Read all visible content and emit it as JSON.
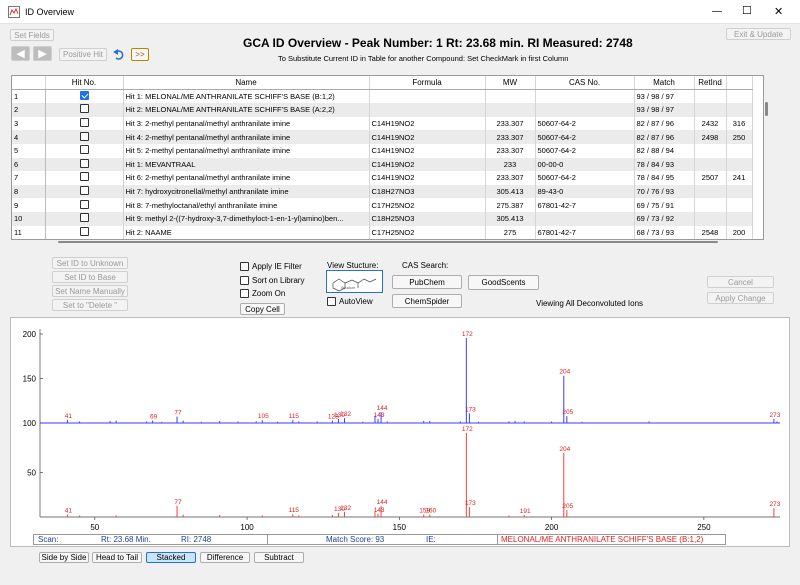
{
  "window": {
    "title": "ID Overview",
    "min": "—",
    "max": "☐",
    "close": "✕"
  },
  "toolbar": {
    "set_fields": "Set Fields",
    "positive_hit": "Positive Hit",
    "next": ">>",
    "exit_update": "Exit & Update"
  },
  "header": {
    "title": "GCA ID Overview - Peak Number: 1  Rt: 23.68 min.  RI Measured: 2748",
    "subtitle": "To Substitute Current ID in Table for another Compound: Set CheckMark in first Column"
  },
  "table": {
    "columns": [
      "",
      "Hit No.",
      "Name",
      "Formula",
      "MW",
      "CAS No.",
      "Match",
      "RetInd",
      ""
    ],
    "rows": [
      {
        "n": "1",
        "checked": true,
        "name": "Hit  1: MELONAL/ME ANTHRANILATE SCHIFF'S BASE (B:1,2)",
        "formula": "",
        "mw": "",
        "cas": "",
        "match": "93 / 98 / 97",
        "ri": "",
        "x": ""
      },
      {
        "n": "2",
        "checked": false,
        "name": "Hit  2: MELONAL/ME ANTHRANILATE SCHIFF'S BASE (A:2,2)",
        "formula": "",
        "mw": "",
        "cas": "",
        "match": "93 / 98 / 97",
        "ri": "",
        "x": ""
      },
      {
        "n": "3",
        "checked": false,
        "name": "Hit  3: 2-methyl pentanal/methyl anthranilate imine",
        "formula": "C14H19NO2",
        "mw": "233.307",
        "cas": "50607-64-2",
        "match": "82 / 87 / 96",
        "ri": "2432",
        "x": "316"
      },
      {
        "n": "4",
        "checked": false,
        "name": "Hit  4: 2-methyl pentanal/methyl anthranilate imine",
        "formula": "C14H19NO2",
        "mw": "233.307",
        "cas": "50607-64-2",
        "match": "82 / 87 / 96",
        "ri": "2498",
        "x": "250"
      },
      {
        "n": "5",
        "checked": false,
        "name": "Hit  5: 2-methyl pentanal/methyl anthranilate imine",
        "formula": "C14H19NO2",
        "mw": "233.307",
        "cas": "50607-64-2",
        "match": "82 / 88 / 94",
        "ri": "",
        "x": ""
      },
      {
        "n": "6",
        "checked": false,
        "name": "Hit  1: MEVANTRAAL",
        "formula": "C14H19NO2",
        "mw": "233",
        "cas": "00-00-0",
        "match": "78 / 84 / 93",
        "ri": "",
        "x": ""
      },
      {
        "n": "7",
        "checked": false,
        "name": "Hit  6: 2-methyl pentanal/methyl anthranilate imine",
        "formula": "C14H19NO2",
        "mw": "233.307",
        "cas": "50607-64-2",
        "match": "78 / 84 / 95",
        "ri": "2507",
        "x": "241"
      },
      {
        "n": "8",
        "checked": false,
        "name": "Hit  7: hydroxycitronellal/methyl anthranilate imine",
        "formula": "C18H27NO3",
        "mw": "305.413",
        "cas": "89-43-0",
        "match": "70 / 76 / 93",
        "ri": "",
        "x": ""
      },
      {
        "n": "9",
        "checked": false,
        "name": "Hit  8: 7-methyloctanal/ethyl anthranilate imine",
        "formula": "C17H25NO2",
        "mw": "275.387",
        "cas": "67801-42-7",
        "match": "69 / 75 / 91",
        "ri": "",
        "x": ""
      },
      {
        "n": "10",
        "checked": false,
        "name": "Hit  9: methyl 2-((7-hydroxy-3,7-dimethyloct-1-en-1-yl)amino)ben...",
        "formula": "C18H25NO3",
        "mw": "305.413",
        "cas": "",
        "match": "69 / 73 / 92",
        "ri": "",
        "x": ""
      },
      {
        "n": "11",
        "checked": false,
        "name": "Hit  2: NAAME",
        "formula": "C17H25NO2",
        "mw": "275",
        "cas": "67801-42-7",
        "match": "68 / 73 / 93",
        "ri": "2548",
        "x": "200"
      }
    ]
  },
  "actions": {
    "set_unknown": "Set ID to Unknown",
    "set_base": "Set ID to Base",
    "set_manual": "Set Name Manually",
    "set_delete": "Set to \"Delete \"",
    "copy_cell": "Copy Cell",
    "cancel": "Cancel",
    "apply_change": "Apply Change"
  },
  "options": {
    "apply_ie": "Apply IE Filter",
    "sort_library": "Sort on Library",
    "zoom_on": "Zoom On",
    "auto_view": "AutoView"
  },
  "structure": {
    "label": "View Stucture:",
    "caption": "Structure"
  },
  "cas_search": {
    "label": "CAS Search:",
    "pubchem": "PubChem",
    "chemspider": "ChemSpider",
    "goodscents": "GoodScents"
  },
  "ions_note": "Viewing All Deconvoluted Ions",
  "status": {
    "scan": "Scan:",
    "rt": "Rt: 23.68 Min.",
    "ri": "RI: 2748",
    "match": "Match Score: 93",
    "ie": "IE:",
    "name": "MELONAL/ME ANTHRANILATE SCHIFF'S BASE (B:1,2)"
  },
  "view_modes": {
    "side": "Side by Side",
    "head": "Head to Tail",
    "stacked": "Stacked",
    "diff": "Difference",
    "sub": "Subtract"
  },
  "colors": {
    "top": "#3b3bff",
    "bottom": "#ff3b3b",
    "label": "#e02020",
    "accent": "#1a73e8"
  },
  "chart_data": {
    "type": "bar",
    "xlim": [
      32,
      275
    ],
    "yticks_top": [
      100,
      150,
      200
    ],
    "yticks_bottom": [
      50
    ],
    "xticks": [
      50,
      100,
      150,
      200,
      250
    ],
    "top": {
      "peaks": [
        [
          41,
          8
        ],
        [
          45,
          4
        ],
        [
          55,
          5
        ],
        [
          57,
          6
        ],
        [
          67,
          4
        ],
        [
          69,
          6
        ],
        [
          72,
          3
        ],
        [
          77,
          16
        ],
        [
          79,
          6
        ],
        [
          85,
          3
        ],
        [
          91,
          5
        ],
        [
          97,
          4
        ],
        [
          103,
          4
        ],
        [
          105,
          7
        ],
        [
          110,
          3
        ],
        [
          115,
          7
        ],
        [
          117,
          4
        ],
        [
          123,
          4
        ],
        [
          128,
          6
        ],
        [
          130,
          10
        ],
        [
          132,
          12
        ],
        [
          138,
          3
        ],
        [
          142,
          18
        ],
        [
          143,
          10
        ],
        [
          144,
          27
        ],
        [
          146,
          4
        ],
        [
          158,
          5
        ],
        [
          160,
          5
        ],
        [
          170,
          4
        ],
        [
          172,
          212
        ],
        [
          173,
          24
        ],
        [
          176,
          3
        ],
        [
          186,
          4
        ],
        [
          188,
          5
        ],
        [
          191,
          4
        ],
        [
          200,
          4
        ],
        [
          204,
          118
        ],
        [
          205,
          17
        ],
        [
          210,
          3
        ],
        [
          232,
          4
        ],
        [
          273,
          10
        ],
        [
          274,
          4
        ]
      ],
      "labels": [
        [
          41,
          "41"
        ],
        [
          69,
          "69"
        ],
        [
          77,
          "77"
        ],
        [
          105,
          "105"
        ],
        [
          115,
          "115"
        ],
        [
          128,
          "128"
        ],
        [
          130,
          "130"
        ],
        [
          132,
          "132"
        ],
        [
          143,
          "143"
        ],
        [
          144,
          "144"
        ],
        [
          172,
          "172"
        ],
        [
          173,
          "173"
        ],
        [
          204,
          "204"
        ],
        [
          205,
          "205"
        ],
        [
          273,
          "273"
        ]
      ]
    },
    "bottom": {
      "peaks": [
        [
          41,
          6
        ],
        [
          45,
          4
        ],
        [
          57,
          4
        ],
        [
          77,
          28
        ],
        [
          79,
          6
        ],
        [
          91,
          5
        ],
        [
          105,
          4
        ],
        [
          115,
          7
        ],
        [
          117,
          4
        ],
        [
          128,
          5
        ],
        [
          130,
          10
        ],
        [
          132,
          13
        ],
        [
          142,
          12
        ],
        [
          143,
          8
        ],
        [
          144,
          27
        ],
        [
          158,
          6
        ],
        [
          160,
          6
        ],
        [
          172,
          210
        ],
        [
          173,
          25
        ],
        [
          186,
          4
        ],
        [
          191,
          5
        ],
        [
          204,
          160
        ],
        [
          205,
          17
        ],
        [
          273,
          22
        ]
      ],
      "labels": [
        [
          41,
          "41"
        ],
        [
          77,
          "77"
        ],
        [
          115,
          "115"
        ],
        [
          130,
          "130"
        ],
        [
          132,
          "132"
        ],
        [
          143,
          "143"
        ],
        [
          144,
          "144"
        ],
        [
          158,
          "158"
        ],
        [
          160,
          "160"
        ],
        [
          172,
          "172"
        ],
        [
          173,
          "173"
        ],
        [
          191,
          "191"
        ],
        [
          204,
          "204"
        ],
        [
          205,
          "205"
        ],
        [
          273,
          "273"
        ]
      ]
    }
  }
}
